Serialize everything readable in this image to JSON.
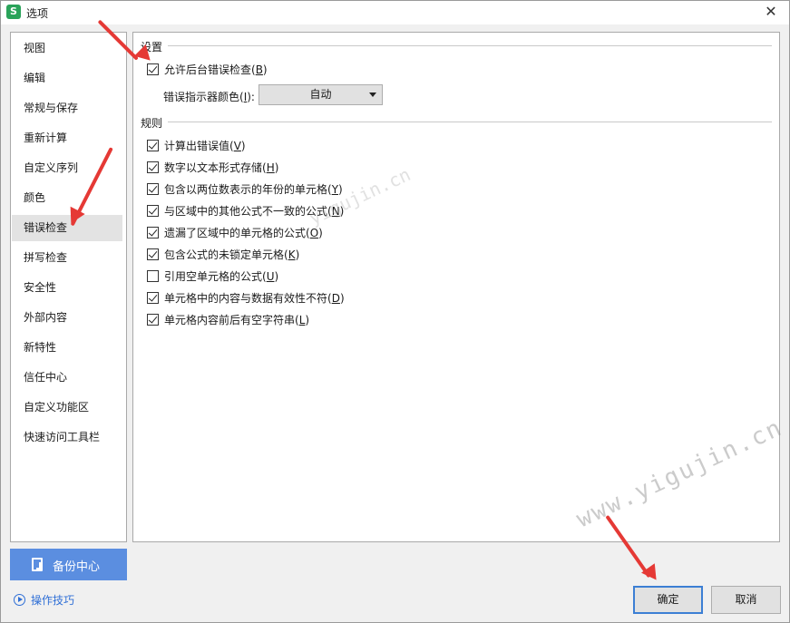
{
  "window": {
    "title": "选项",
    "app_icon_letter": "S",
    "close_symbol": "✕"
  },
  "sidebar": {
    "items": [
      {
        "label": "视图",
        "active": false
      },
      {
        "label": "编辑",
        "active": false
      },
      {
        "label": "常规与保存",
        "active": false
      },
      {
        "label": "重新计算",
        "active": false
      },
      {
        "label": "自定义序列",
        "active": false
      },
      {
        "label": "颜色",
        "active": false
      },
      {
        "label": "错误检查",
        "active": true
      },
      {
        "label": "拼写检查",
        "active": false
      },
      {
        "label": "安全性",
        "active": false
      },
      {
        "label": "外部内容",
        "active": false
      },
      {
        "label": "新特性",
        "active": false
      },
      {
        "label": "信任中心",
        "active": false
      },
      {
        "label": "自定义功能区",
        "active": false
      },
      {
        "label": "快速访问工具栏",
        "active": false
      }
    ],
    "backup_label": "备份中心",
    "tips_label": "操作技巧"
  },
  "settings": {
    "group_title": "设置",
    "allow_background": {
      "text": "允许后台错误检查(",
      "key": "B",
      "suffix": ")",
      "checked": true
    },
    "indicator_color_label": {
      "text": "错误指示器颜色(",
      "key": "I",
      "suffix": "):"
    },
    "indicator_color_value": "自动"
  },
  "rules": {
    "group_title": "规则",
    "items": [
      {
        "text": "计算出错误值(",
        "key": "V",
        "suffix": ")",
        "checked": true
      },
      {
        "text": "数字以文本形式存储(",
        "key": "H",
        "suffix": ")",
        "checked": true
      },
      {
        "text": "包含以两位数表示的年份的单元格(",
        "key": "Y",
        "suffix": ")",
        "checked": true
      },
      {
        "text": "与区域中的其他公式不一致的公式(",
        "key": "N",
        "suffix": ")",
        "checked": true
      },
      {
        "text": "遗漏了区域中的单元格的公式(",
        "key": "O",
        "suffix": ")",
        "checked": true
      },
      {
        "text": "包含公式的未锁定单元格(",
        "key": "K",
        "suffix": ")",
        "checked": true
      },
      {
        "text": "引用空单元格的公式(",
        "key": "U",
        "suffix": ")",
        "checked": false
      },
      {
        "text": "单元格中的内容与数据有效性不符(",
        "key": "D",
        "suffix": ")",
        "checked": true
      },
      {
        "text": "单元格内容前后有空字符串(",
        "key": "L",
        "suffix": ")",
        "checked": true
      }
    ]
  },
  "footer": {
    "ok_label": "确定",
    "cancel_label": "取消"
  },
  "watermarks": [
    "www.yigujin.cn",
    "yigujin.cn"
  ],
  "colors": {
    "accent": "#5b8ee0",
    "link": "#2f6fd6",
    "annotation_arrow": "#e53935"
  }
}
